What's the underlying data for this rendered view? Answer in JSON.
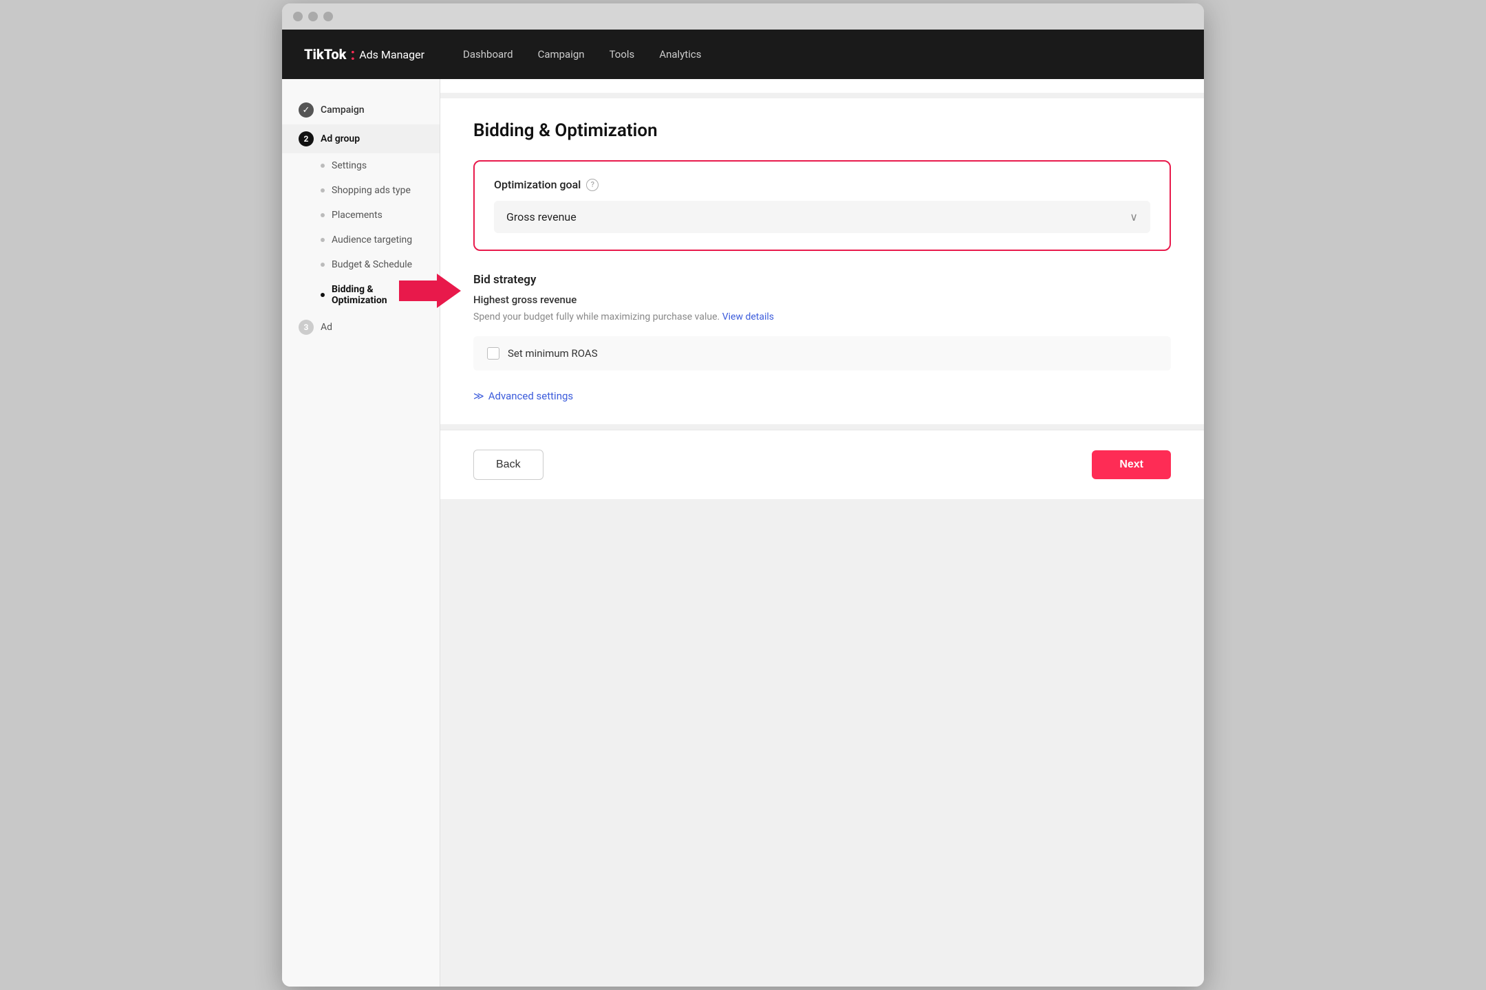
{
  "browser": {
    "dots": [
      "dot1",
      "dot2",
      "dot3"
    ]
  },
  "topnav": {
    "logo_tiktok": "TikTok",
    "logo_colon": ":",
    "logo_ads": "Ads Manager",
    "links": [
      {
        "label": "Dashboard",
        "id": "dashboard"
      },
      {
        "label": "Campaign",
        "id": "campaign"
      },
      {
        "label": "Tools",
        "id": "tools"
      },
      {
        "label": "Analytics",
        "id": "analytics"
      }
    ]
  },
  "sidebar": {
    "campaign_label": "Campaign",
    "adgroup_label": "Ad group",
    "adgroup_number": "2",
    "settings_label": "Settings",
    "shopping_ads_label": "Shopping ads type",
    "placements_label": "Placements",
    "audience_label": "Audience targeting",
    "budget_label": "Budget & Schedule",
    "bidding_label": "Bidding & Optimization",
    "ad_label": "Ad",
    "ad_number": "3"
  },
  "main": {
    "section_title": "Bidding & Optimization",
    "optimization_goal_label": "Optimization goal",
    "optimization_goal_value": "Gross revenue",
    "bid_strategy_title": "Bid strategy",
    "bid_strategy_subtitle": "Highest gross revenue",
    "bid_strategy_desc": "Spend your budget fully while maximizing purchase value.",
    "bid_strategy_link": "View details",
    "roas_label": "Set minimum ROAS",
    "advanced_settings_label": "Advanced settings",
    "advanced_chevron": "≫"
  },
  "footer": {
    "back_label": "Back",
    "next_label": "Next"
  }
}
